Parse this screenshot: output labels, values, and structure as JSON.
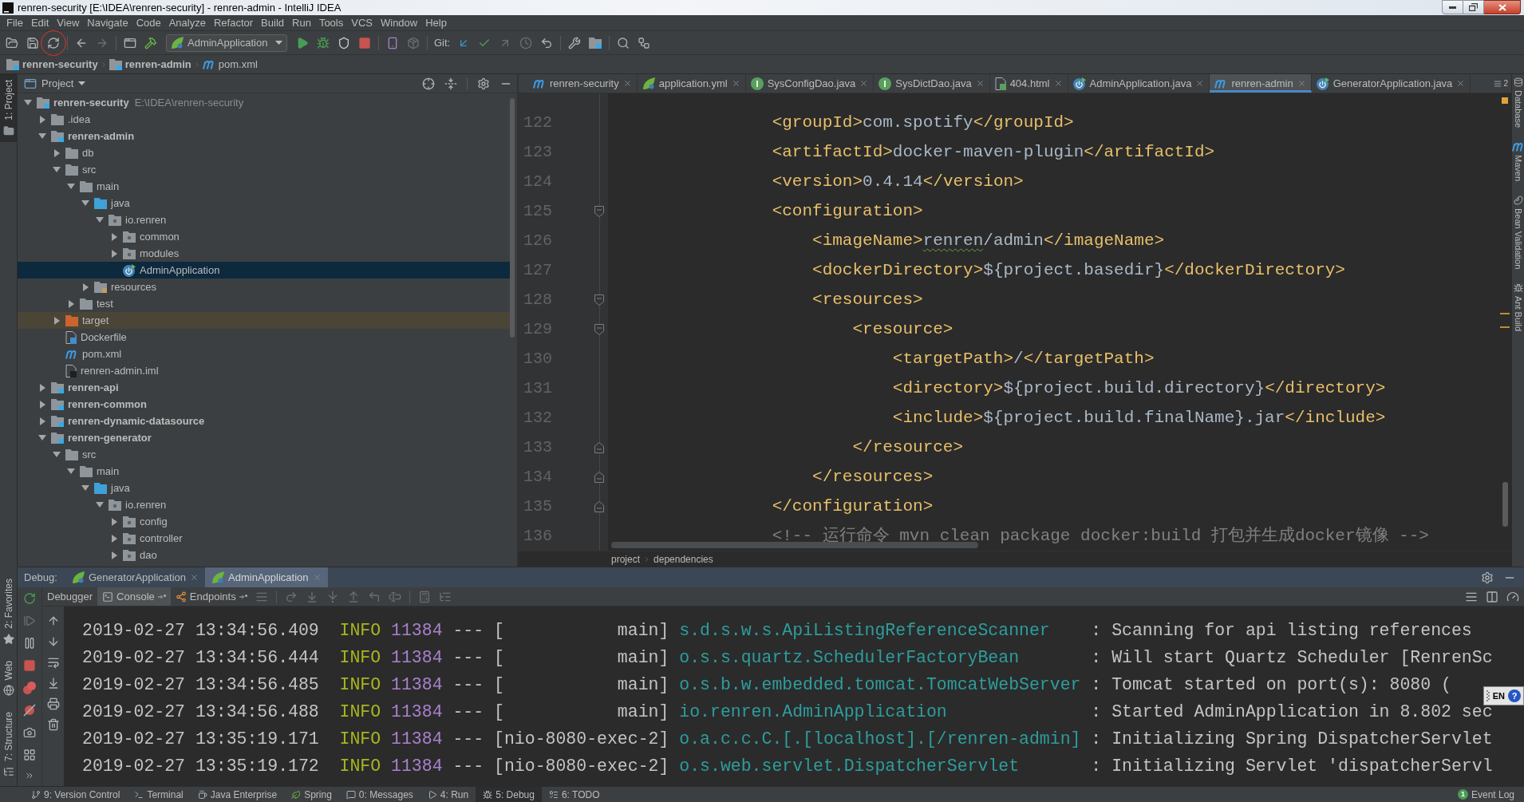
{
  "window": {
    "title": "renren-security [E:\\IDEA\\renren-security] - renren-admin - IntelliJ IDEA"
  },
  "menu": [
    "File",
    "Edit",
    "View",
    "Navigate",
    "Code",
    "Analyze",
    "Refactor",
    "Build",
    "Run",
    "Tools",
    "VCS",
    "Window",
    "Help"
  ],
  "toolbar": {
    "run_configuration": "AdminApplication",
    "vcs_label": "Git:"
  },
  "breadcrumbs": [
    {
      "kind": "module",
      "label": "renren-security"
    },
    {
      "kind": "module",
      "label": "renren-admin"
    },
    {
      "kind": "maven",
      "label": "pom.xml"
    }
  ],
  "left_strip": {
    "top": [
      {
        "label": "1: Project",
        "selected": true
      }
    ],
    "bottom": [
      {
        "label": "2: Favorites",
        "selected": false
      },
      {
        "label": "Web",
        "selected": false
      },
      {
        "label": "7: Structure",
        "selected": false
      }
    ]
  },
  "project_panel": {
    "title": "Project",
    "tree": [
      {
        "label": "renren-security",
        "path": "E:\\IDEA\\renren-security",
        "kind": "module",
        "expanded": true,
        "selected": false,
        "children": [
          {
            "label": ".idea",
            "kind": "folder",
            "expanded": false,
            "selected": false
          },
          {
            "label": "renren-admin",
            "kind": "module",
            "expanded": true,
            "selected": false,
            "children": [
              {
                "label": "db",
                "kind": "folder",
                "expanded": false,
                "selected": false
              },
              {
                "label": "src",
                "kind": "folder",
                "expanded": true,
                "selected": false,
                "children": [
                  {
                    "label": "main",
                    "kind": "folder",
                    "expanded": true,
                    "selected": false,
                    "children": [
                      {
                        "label": "java",
                        "kind": "source",
                        "expanded": true,
                        "selected": false,
                        "children": [
                          {
                            "label": "io.renren",
                            "kind": "package",
                            "expanded": true,
                            "selected": false,
                            "children": [
                              {
                                "label": "common",
                                "kind": "package",
                                "expanded": false,
                                "selected": false
                              },
                              {
                                "label": "modules",
                                "kind": "package",
                                "expanded": false,
                                "selected": false
                              },
                              {
                                "label": "AdminApplication",
                                "kind": "application",
                                "selected": true
                              }
                            ]
                          }
                        ]
                      },
                      {
                        "label": "resources",
                        "kind": "resources",
                        "expanded": false,
                        "selected": false
                      }
                    ]
                  },
                  {
                    "label": "test",
                    "kind": "folder",
                    "expanded": false,
                    "selected": false
                  }
                ]
              },
              {
                "label": "target",
                "kind": "excluded",
                "expanded": false,
                "selected": false
              },
              {
                "label": "Dockerfile",
                "kind": "dockerfile",
                "selected": false
              },
              {
                "label": "pom.xml",
                "kind": "maven",
                "selected": false
              },
              {
                "label": "renren-admin.iml",
                "kind": "iml",
                "selected": false
              }
            ]
          },
          {
            "label": "renren-api",
            "kind": "module",
            "expanded": false,
            "selected": false
          },
          {
            "label": "renren-common",
            "kind": "module",
            "expanded": false,
            "selected": false
          },
          {
            "label": "renren-dynamic-datasource",
            "kind": "module",
            "expanded": false,
            "selected": false
          },
          {
            "label": "renren-generator",
            "kind": "module",
            "expanded": true,
            "selected": false,
            "children": [
              {
                "label": "src",
                "kind": "folder",
                "expanded": true,
                "selected": false,
                "children": [
                  {
                    "label": "main",
                    "kind": "folder",
                    "expanded": true,
                    "selected": false,
                    "children": [
                      {
                        "label": "java",
                        "kind": "source",
                        "expanded": true,
                        "selected": false,
                        "children": [
                          {
                            "label": "io.renren",
                            "kind": "package",
                            "expanded": true,
                            "selected": false,
                            "children": [
                              {
                                "label": "config",
                                "kind": "package",
                                "expanded": false,
                                "selected": false
                              },
                              {
                                "label": "controller",
                                "kind": "package",
                                "expanded": false,
                                "selected": false
                              },
                              {
                                "label": "dao",
                                "kind": "package",
                                "expanded": false,
                                "selected": false
                              }
                            ]
                          }
                        ]
                      }
                    ]
                  }
                ]
              }
            ]
          }
        ]
      }
    ]
  },
  "editor": {
    "tabs": [
      {
        "label": "renren-security",
        "kind": "maven",
        "selected": false
      },
      {
        "label": "application.yml",
        "kind": "yaml",
        "selected": false
      },
      {
        "label": "SysConfigDao.java",
        "kind": "interface",
        "selected": false
      },
      {
        "label": "SysDictDao.java",
        "kind": "interface",
        "selected": false
      },
      {
        "label": "404.html",
        "kind": "html",
        "selected": false
      },
      {
        "label": "AdminApplication.java",
        "kind": "application",
        "selected": false
      },
      {
        "label": "renren-admin",
        "kind": "maven",
        "selected": true
      },
      {
        "label": "GeneratorApplication.java",
        "kind": "application",
        "selected": false
      }
    ],
    "hidden_tabs": "2",
    "lines": [
      {
        "number": "122",
        "kind": "plain",
        "segments": [
          {
            "kind": "tag",
            "text": "                <groupId>"
          },
          {
            "kind": "text",
            "text": "com.spotify"
          },
          {
            "kind": "tag",
            "text": "</groupId>"
          }
        ]
      },
      {
        "number": "123",
        "kind": "plain",
        "segments": [
          {
            "kind": "tag",
            "text": "                <artifactId>"
          },
          {
            "kind": "text",
            "text": "docker-maven-plugin"
          },
          {
            "kind": "tag",
            "text": "</artifactId>"
          }
        ]
      },
      {
        "number": "124",
        "kind": "plain",
        "segments": [
          {
            "kind": "tag",
            "text": "                <version>"
          },
          {
            "kind": "text",
            "text": "0.4.14"
          },
          {
            "kind": "tag",
            "text": "</version>"
          }
        ]
      },
      {
        "number": "125",
        "kind": "fold-start",
        "segments": [
          {
            "kind": "tag",
            "text": "                <configuration>"
          }
        ]
      },
      {
        "number": "126",
        "kind": "plain",
        "segments": [
          {
            "kind": "tag",
            "text": "                    <imageName>"
          },
          {
            "kind": "typo",
            "text": "renren"
          },
          {
            "kind": "text",
            "text": "/admin"
          },
          {
            "kind": "tag",
            "text": "</imageName>"
          }
        ]
      },
      {
        "number": "127",
        "kind": "plain",
        "segments": [
          {
            "kind": "tag",
            "text": "                    <dockerDirectory>"
          },
          {
            "kind": "text",
            "text": "${project.basedir}"
          },
          {
            "kind": "tag",
            "text": "</dockerDirectory>"
          }
        ]
      },
      {
        "number": "128",
        "kind": "fold-start",
        "segments": [
          {
            "kind": "tag",
            "text": "                    <resources>"
          }
        ]
      },
      {
        "number": "129",
        "kind": "fold-start",
        "segments": [
          {
            "kind": "tag",
            "text": "                        <resource>"
          }
        ]
      },
      {
        "number": "130",
        "kind": "plain",
        "segments": [
          {
            "kind": "tag",
            "text": "                            <targetPath>"
          },
          {
            "kind": "text",
            "text": "/"
          },
          {
            "kind": "tag",
            "text": "</targetPath>"
          }
        ]
      },
      {
        "number": "131",
        "kind": "plain",
        "segments": [
          {
            "kind": "tag",
            "text": "                            <directory>"
          },
          {
            "kind": "text",
            "text": "${project.build.directory}"
          },
          {
            "kind": "tag",
            "text": "</directory>"
          }
        ]
      },
      {
        "number": "132",
        "kind": "plain",
        "segments": [
          {
            "kind": "tag",
            "text": "                            <include>"
          },
          {
            "kind": "text",
            "text": "${project.build.finalName}.jar"
          },
          {
            "kind": "tag",
            "text": "</include>"
          }
        ]
      },
      {
        "number": "133",
        "kind": "fold-end",
        "segments": [
          {
            "kind": "tag",
            "text": "                        </resource>"
          }
        ]
      },
      {
        "number": "134",
        "kind": "fold-end",
        "segments": [
          {
            "kind": "tag",
            "text": "                    </resources>"
          }
        ]
      },
      {
        "number": "135",
        "kind": "fold-end",
        "segments": [
          {
            "kind": "tag",
            "text": "                </configuration>"
          }
        ]
      },
      {
        "number": "136",
        "kind": "plain",
        "segments": [
          {
            "kind": "comment",
            "text": "                <!-- 运行命令 mvn clean package docker:build 打包并生成docker镜像 -->"
          }
        ]
      }
    ],
    "breadcrumb": [
      "project",
      "dependencies"
    ]
  },
  "right_strip": [
    "Database",
    "Maven",
    "Bean Validation",
    "Ant Build"
  ],
  "debug": {
    "label": "Debug:",
    "sessions": [
      {
        "label": "GeneratorApplication",
        "selected": false
      },
      {
        "label": "AdminApplication",
        "selected": true
      }
    ],
    "tabs": [
      {
        "label": "Debugger",
        "selected": false
      },
      {
        "label": "Console",
        "selected": true
      },
      {
        "label": "Endpoints",
        "selected": false
      }
    ],
    "console": [
      {
        "timestamp": "2019-02-27 13:34:56.409",
        "level": "INFO",
        "pid": "11384",
        "separator": "---",
        "thread": "[           main]",
        "logger": "s.d.s.w.s.ApiListingReferenceScanner",
        "message": ": Scanning for api listing references"
      },
      {
        "timestamp": "2019-02-27 13:34:56.444",
        "level": "INFO",
        "pid": "11384",
        "separator": "---",
        "thread": "[           main]",
        "logger": "o.s.s.quartz.SchedulerFactoryBean",
        "message": ": Will start Quartz Scheduler [RenrenSc"
      },
      {
        "timestamp": "2019-02-27 13:34:56.485",
        "level": "INFO",
        "pid": "11384",
        "separator": "---",
        "thread": "[           main]",
        "logger": "o.s.b.w.embedded.tomcat.TomcatWebServer",
        "message": ": Tomcat started on port(s): 8080 ("
      },
      {
        "timestamp": "2019-02-27 13:34:56.488",
        "level": "INFO",
        "pid": "11384",
        "separator": "---",
        "thread": "[           main]",
        "logger": "io.renren.AdminApplication",
        "message": ": Started AdminApplication in 8.802 sec"
      },
      {
        "timestamp": "2019-02-27 13:35:19.171",
        "level": "INFO",
        "pid": "11384",
        "separator": "---",
        "thread": "[nio-8080-exec-2]",
        "logger": "o.a.c.c.C.[.[localhost].[/renren-admin]",
        "message": ": Initializing Spring DispatcherServlet"
      },
      {
        "timestamp": "2019-02-27 13:35:19.172",
        "level": "INFO",
        "pid": "11384",
        "separator": "---",
        "thread": "[nio-8080-exec-2]",
        "logger": "o.s.web.servlet.DispatcherServlet",
        "message": ": Initializing Servlet 'dispatcherServl"
      }
    ]
  },
  "language_bar": {
    "label": "EN",
    "help": "?"
  },
  "status_bar": {
    "tools": [
      {
        "label": "9: Version Control",
        "selected": false
      },
      {
        "label": "Terminal",
        "selected": false
      },
      {
        "label": "Java Enterprise",
        "selected": false
      },
      {
        "label": "Spring",
        "selected": false
      },
      {
        "label": "0: Messages",
        "selected": false
      },
      {
        "label": "4: Run",
        "selected": false
      },
      {
        "label": "5: Debug",
        "selected": true
      },
      {
        "label": "6: TODO",
        "selected": false
      }
    ],
    "event_log": {
      "label": "Event Log",
      "count": "1"
    }
  }
}
